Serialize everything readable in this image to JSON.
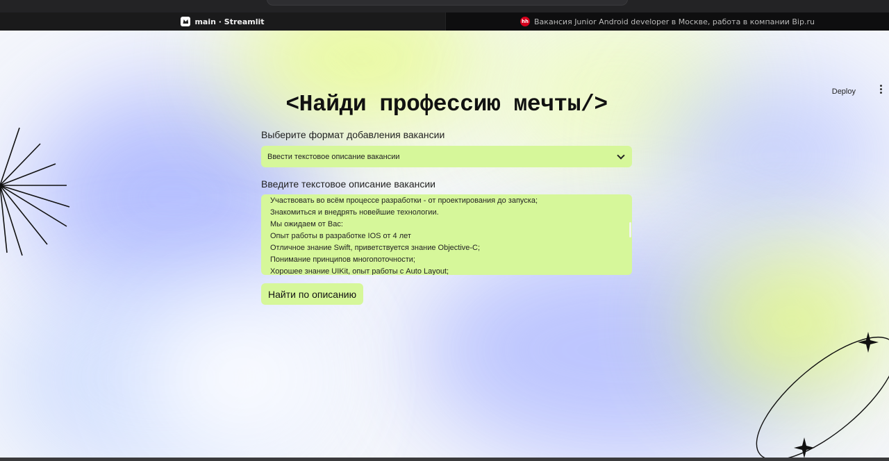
{
  "browser": {
    "tabs": [
      {
        "title": "main · Streamlit",
        "active": true,
        "icon": "streamlit-crown-icon"
      },
      {
        "title": "Вакансия Junior Android developer в Москве, работа в компании Bip.ru",
        "active": false,
        "icon": "hh-logo-icon",
        "icon_text": "hh"
      }
    ]
  },
  "header": {
    "deploy_label": "Deploy",
    "menu_icon": "kebab-menu-icon"
  },
  "main": {
    "title": "<Найди профессию мечты/>",
    "format_label": "Выберите формат добавления вакансии",
    "format_selected": "Ввести текстовое описание вакансии",
    "description_label": "Введите текстовое описание вакансии",
    "description_lines": [
      "Участвовать во всём процессе разработки - от проектирования до запуска;",
      "Знакомиться и внедрять новейшие технологии.",
      "Мы ожидаем от Вас:",
      "Опыт работы в разработке IOS от 4 лет",
      "Отличное знание Swift, приветствуется знание Objective-C;",
      "Понимание принципов многопоточности;",
      "Хорошее знание UIKit, опыт работы с Auto Layout;"
    ],
    "submit_label": "Найти по описанию"
  },
  "colors": {
    "accent": "#d6f79a",
    "blob_blue": "#a9b6ff",
    "blob_lime": "#e3fb8a",
    "chrome_bg": "#232325"
  }
}
